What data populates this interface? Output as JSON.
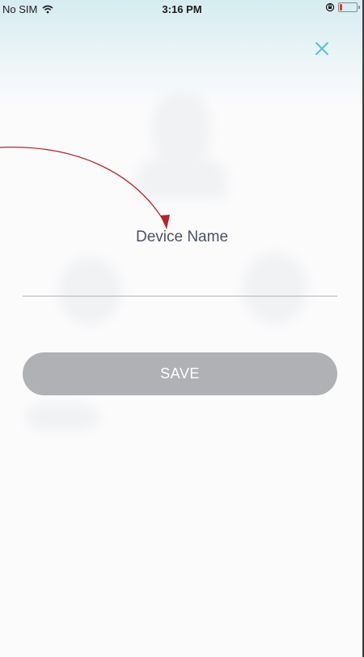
{
  "status_bar": {
    "carrier": "No SIM",
    "time": "3:16 PM",
    "battery_level": 0.15,
    "icons": [
      "wifi-icon",
      "orientation-lock-icon",
      "battery-icon"
    ],
    "battery_color": "#e0353b"
  },
  "header": {
    "close_icon": "close-icon",
    "close_color": "#5bbfd0"
  },
  "form": {
    "title": "Device Name",
    "name_input_value": "",
    "save_label": "SAVE"
  },
  "colors": {
    "save_button": "#b0b1b4",
    "title_text": "#4a5360",
    "annotation_arrow": "#b3262d"
  }
}
